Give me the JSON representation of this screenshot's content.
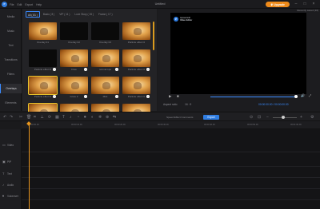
{
  "app": {
    "logo_text": "P",
    "title": "Untitled",
    "menu": [
      "File",
      "Edit",
      "Export",
      "Help"
    ],
    "upgrade_label": "Upgrade",
    "window_controls": [
      "minimize-icon",
      "maximize-icon",
      "close-icon"
    ]
  },
  "sidebar": {
    "items": [
      {
        "label": "Media",
        "active": false
      },
      {
        "label": "Music",
        "active": false
      },
      {
        "label": "Text",
        "active": false
      },
      {
        "label": "Transitions",
        "active": false
      },
      {
        "label": "Filters",
        "active": false
      },
      {
        "label": "Overlays",
        "active": true
      },
      {
        "label": "Elements",
        "active": false
      }
    ]
  },
  "media": {
    "filter_tabs": [
      {
        "label": "All ( 81 )",
        "active": true
      },
      {
        "label": "Basic ( 8 )",
        "active": false
      },
      {
        "label": "VIP ( 11 )",
        "active": false
      },
      {
        "label": "Love Story ( 15 )",
        "active": false
      },
      {
        "label": "Frame ( 17 )",
        "active": false
      }
    ],
    "items": [
      {
        "label": "Overlay 01",
        "scene": "cat",
        "selected": false,
        "download": false
      },
      {
        "label": "Overlay 02",
        "scene": "dark",
        "selected": false,
        "download": false
      },
      {
        "label": "Overlay 03",
        "scene": "dark",
        "selected": false,
        "download": false
      },
      {
        "label": "Particle effect 0",
        "scene": "cat",
        "selected": false,
        "download": false
      },
      {
        "label": "Particle effect 0",
        "scene": "dark",
        "selected": false,
        "download": true
      },
      {
        "label": "Flow",
        "scene": "cat",
        "selected": false,
        "download": true
      },
      {
        "label": "normal spo",
        "scene": "cat",
        "selected": false,
        "download": true
      },
      {
        "label": "Particle effect 0",
        "scene": "cat",
        "selected": false,
        "download": true
      },
      {
        "label": "Particle effect 0",
        "scene": "cat",
        "selected": true,
        "download": true
      },
      {
        "label": "Grow 2",
        "scene": "cat",
        "selected": false,
        "download": true
      },
      {
        "label": "Mist",
        "scene": "cat",
        "selected": false,
        "download": true
      },
      {
        "label": "Particle effect 0",
        "scene": "cat",
        "selected": false,
        "download": true
      },
      {
        "label": "",
        "scene": "cat",
        "selected": true,
        "download": false
      },
      {
        "label": "",
        "scene": "cat",
        "selected": false,
        "download": false
      },
      {
        "label": "",
        "scene": "cat",
        "selected": false,
        "download": false
      },
      {
        "label": "",
        "scene": "cat",
        "selected": false,
        "download": false
      }
    ]
  },
  "preview": {
    "speed_note": "Recently saved (16)",
    "brand_line1": "Apowersoft",
    "brand_line2": "Video Editor",
    "aspect_label": "Aspect ratio",
    "aspect_value": "16 : 9",
    "timecode": "00:00:00.00 / 00:00:00.00"
  },
  "toolbar": {
    "split_label": "Speed Effect Comments",
    "export_label": "Export"
  },
  "ruler": {
    "ticks": [
      "00:00:00.00",
      "00:00:10.00",
      "00:00:20.00",
      "00:00:30.00",
      "00:00:40.00",
      "00:00:50.00",
      "00:01:00.00"
    ]
  },
  "tracks": [
    {
      "label": "Video",
      "icon": "video-icon"
    },
    {
      "label": "PIP",
      "icon": "pip-icon"
    },
    {
      "label": "Text",
      "icon": "text-icon"
    },
    {
      "label": "Audio",
      "icon": "audio-icon"
    },
    {
      "label": "Voiceover",
      "icon": "mic-icon"
    }
  ]
}
